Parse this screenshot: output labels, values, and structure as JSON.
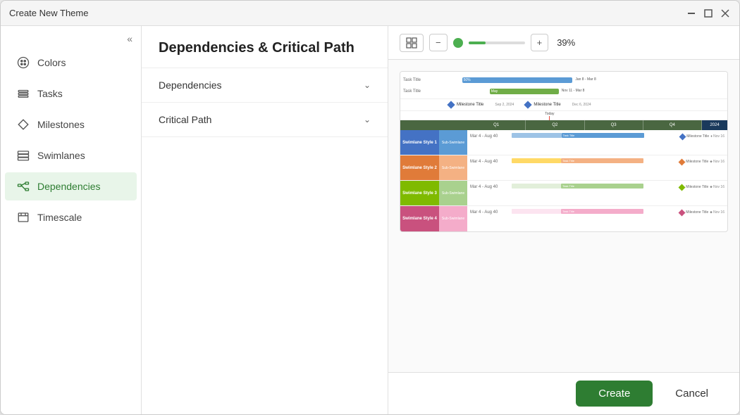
{
  "window": {
    "title": "Create New Theme"
  },
  "sidebar": {
    "collapse_label": "«",
    "items": [
      {
        "id": "colors",
        "label": "Colors",
        "icon": "palette-icon",
        "active": false
      },
      {
        "id": "tasks",
        "label": "Tasks",
        "icon": "tasks-icon",
        "active": false
      },
      {
        "id": "milestones",
        "label": "Milestones",
        "icon": "milestone-icon",
        "active": false
      },
      {
        "id": "swimlanes",
        "label": "Swimlanes",
        "icon": "swimlanes-icon",
        "active": false
      },
      {
        "id": "dependencies",
        "label": "Dependencies",
        "icon": "dependencies-icon",
        "active": true
      },
      {
        "id": "timescale",
        "label": "Timescale",
        "icon": "timescale-icon",
        "active": false
      }
    ]
  },
  "center_panel": {
    "title": "Dependencies & Critical Path",
    "accordion_items": [
      {
        "id": "dependencies",
        "label": "Dependencies"
      },
      {
        "id": "critical_path",
        "label": "Critical Path"
      }
    ]
  },
  "preview": {
    "zoom_value": "39%",
    "zoom_minus": "−",
    "zoom_plus": "+",
    "quarter_labels": [
      "Q1",
      "Q2",
      "Q3",
      "Q4",
      "2024"
    ],
    "today_label": "Today"
  },
  "actions": {
    "create_label": "Create",
    "cancel_label": "Cancel"
  }
}
